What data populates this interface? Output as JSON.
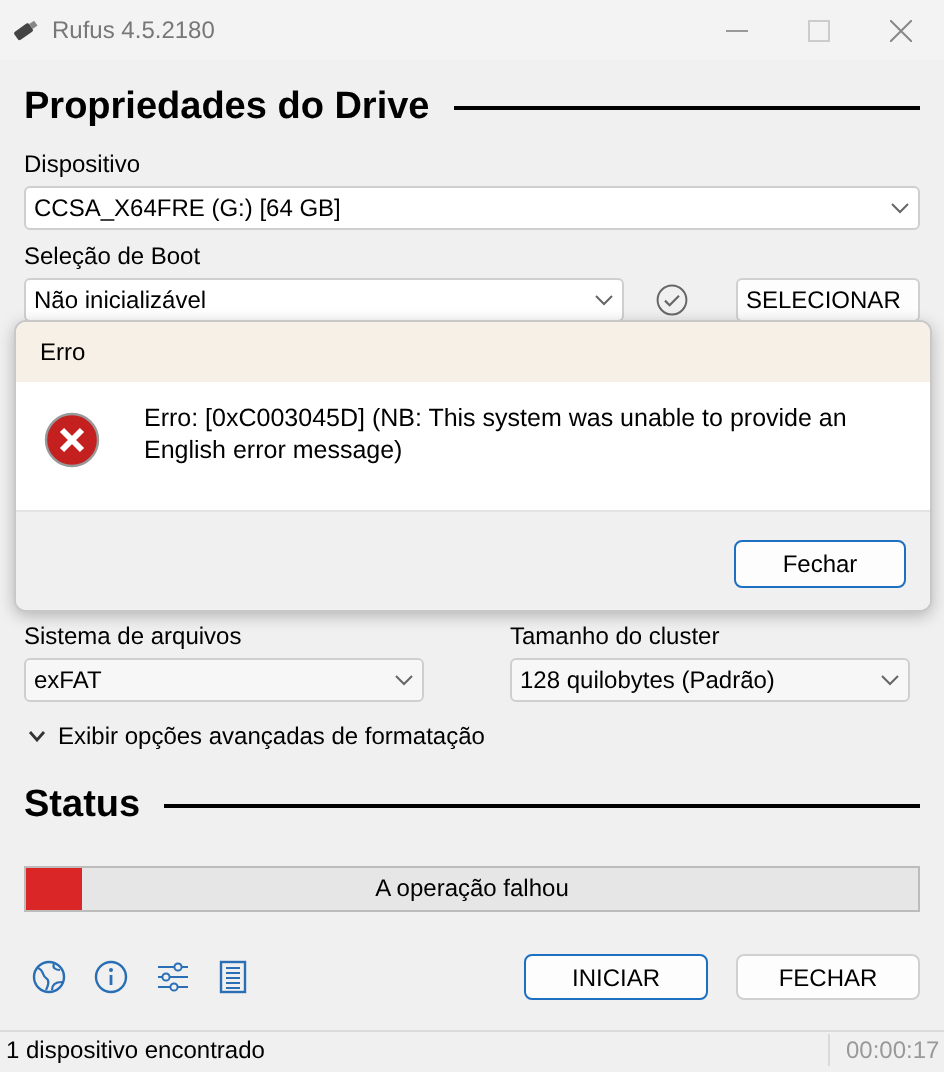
{
  "window": {
    "title": "Rufus 4.5.2180"
  },
  "drive_properties": {
    "heading": "Propriedades do Drive",
    "device_label": "Dispositivo",
    "device_value": "CCSA_X64FRE (G:) [64 GB]",
    "boot_label": "Seleção de Boot",
    "boot_value": "Não inicializável",
    "select_button": "SELECIONAR"
  },
  "dialog": {
    "title": "Erro",
    "message": "Erro: [0xC003045D] (NB: This system was unable to provide an English error message)",
    "button": "Fechar"
  },
  "format": {
    "filesystem_label": "Sistema de arquivos",
    "filesystem_value": "exFAT",
    "cluster_label": "Tamanho do cluster",
    "cluster_value": "128 quilobytes (Padrão)",
    "advanced_toggle": "Exibir opções avançadas de formatação",
    "advanced_expanded": false
  },
  "status": {
    "heading": "Status",
    "progress_text": "A operação falhou",
    "level": 0.063,
    "failed": true
  },
  "buttons": [
    "INICIAR",
    "FECHAR"
  ],
  "status_bar": {
    "message": "1 dispositivo encontrado",
    "time": "00:00:17"
  }
}
